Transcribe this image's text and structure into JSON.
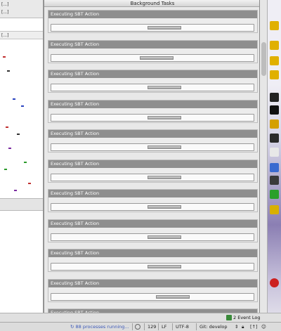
{
  "window": {
    "title": "Background Tasks"
  },
  "tasks": [
    {
      "label": "Executing SBT Action",
      "progress": 0.56
    },
    {
      "label": "Executing SBT Action",
      "progress": 0.52
    },
    {
      "label": "Executing SBT Action",
      "progress": 0.56
    },
    {
      "label": "Executing SBT Action",
      "progress": 0.56
    },
    {
      "label": "Executing SBT Action",
      "progress": 0.56
    },
    {
      "label": "Executing SBT Action",
      "progress": 0.56
    },
    {
      "label": "Executing SBT Action",
      "progress": 0.56
    },
    {
      "label": "Executing SBT Action",
      "progress": 0.56
    },
    {
      "label": "Executing SBT Action",
      "progress": 0.56
    },
    {
      "label": "Executing SBT Action",
      "progress": 0.6
    },
    {
      "label": "Executing SBT Action",
      "progress": null
    }
  ],
  "event_log": {
    "label": "Event Log",
    "badge": "2"
  },
  "statusbar": {
    "processes": "88 processes running...",
    "line": "129",
    "line_sep": "LF",
    "encoding": "UTF-8",
    "vcs": "Git: develop"
  },
  "left_pane": {
    "tab_text": "[...]",
    "toolbar_text": "[...]"
  }
}
